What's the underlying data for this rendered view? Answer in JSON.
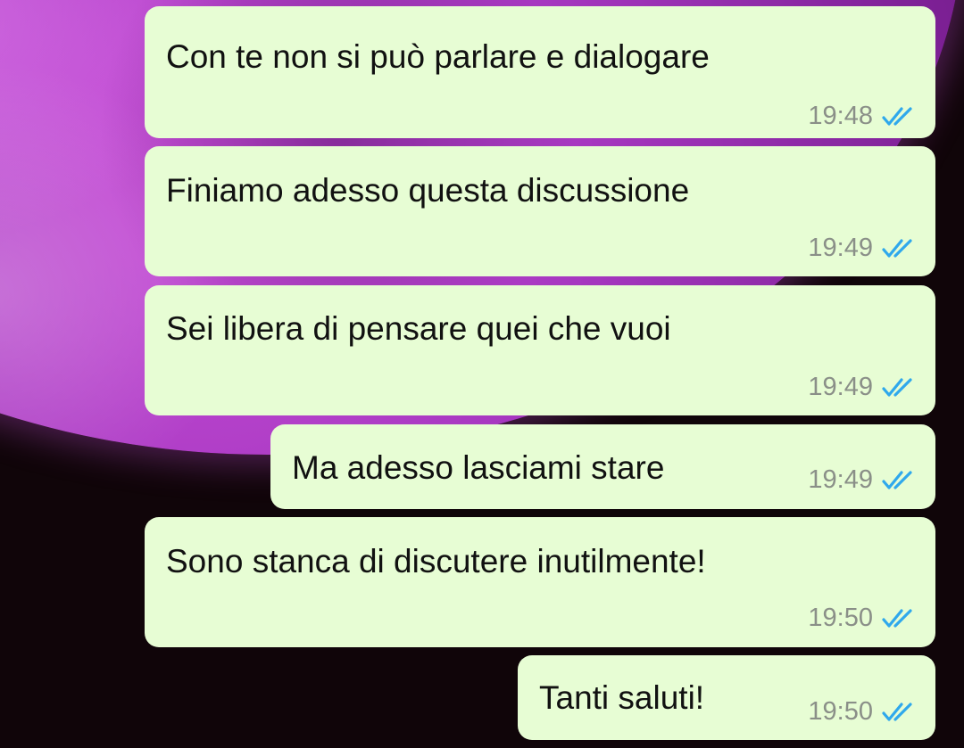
{
  "theme": {
    "bubble_color": "#e7fdd4",
    "tick_color": "#2fa8ec",
    "wallpaper_accent": "#b040c8",
    "background": "#100509"
  },
  "messages": [
    {
      "text": "Con te non si può parlare e dialogare",
      "time": "19:48",
      "status_icon": "double-check-read-icon"
    },
    {
      "text": "Finiamo adesso questa discussione",
      "time": "19:49",
      "status_icon": "double-check-read-icon"
    },
    {
      "text": "Sei libera di pensare quei che vuoi",
      "time": "19:49",
      "status_icon": "double-check-read-icon"
    },
    {
      "text": "Ma adesso lasciami stare",
      "time": "19:49",
      "status_icon": "double-check-read-icon"
    },
    {
      "text": "Sono stanca di discutere inutilmente!",
      "time": "19:50",
      "status_icon": "double-check-read-icon"
    },
    {
      "text": "Tanti saluti!",
      "time": "19:50",
      "status_icon": "double-check-read-icon"
    }
  ]
}
